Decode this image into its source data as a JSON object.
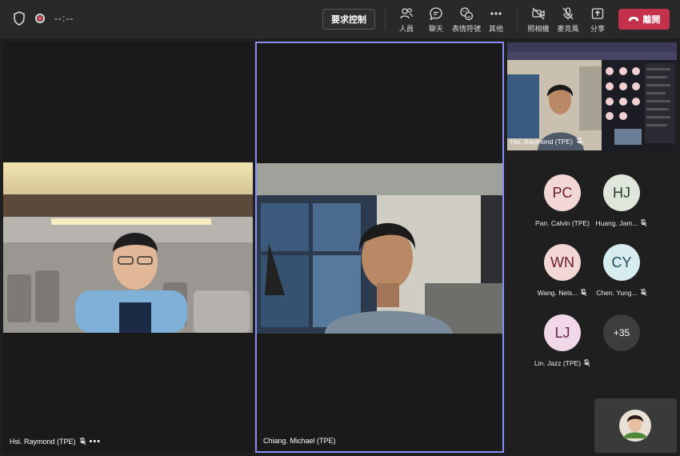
{
  "topbar": {
    "timer": "--:--",
    "request_control": "要求控制",
    "tools": [
      {
        "label": "人員",
        "icon": "people-icon"
      },
      {
        "label": "聊天",
        "icon": "chat-icon"
      },
      {
        "label": "表情符號",
        "icon": "emoji-icon"
      },
      {
        "label": "其他",
        "icon": "more-icon"
      }
    ],
    "media": [
      {
        "label": "照相機",
        "icon": "camera-off-icon"
      },
      {
        "label": "麥克風",
        "icon": "mic-off-icon"
      },
      {
        "label": "分享",
        "icon": "share-icon"
      }
    ],
    "leave": "離開"
  },
  "tiles": {
    "left_name": "Hsi. Raymond (TPE)",
    "center_name": "Chiang. Michael (TPE)",
    "shared_name": "Hsi. Raymond (TPE)"
  },
  "participants": [
    {
      "initials": "PC",
      "name": "Pan. Calvin (TPE)",
      "muted": false,
      "color": "#f3d6d6",
      "text": "#6b1d2b"
    },
    {
      "initials": "HJ",
      "name": "Huang. Jam...",
      "muted": true,
      "color": "#dfe7dc",
      "text": "#2a3a2a"
    },
    {
      "initials": "WN",
      "name": "Wang. Nels...",
      "muted": true,
      "color": "#f3d6d6",
      "text": "#6b1d2b"
    },
    {
      "initials": "CY",
      "name": "Chen. Yung...",
      "muted": true,
      "color": "#d6ecef",
      "text": "#1e4a55"
    },
    {
      "initials": "LJ",
      "name": "Lin. Jazz (TPE)",
      "muted": true,
      "color": "#f1d8e8",
      "text": "#6b1d4e"
    }
  ],
  "overflow": "+35",
  "colors": {
    "accent": "#8b8cf4",
    "leave": "#c4314b",
    "topbar": "#292929"
  }
}
